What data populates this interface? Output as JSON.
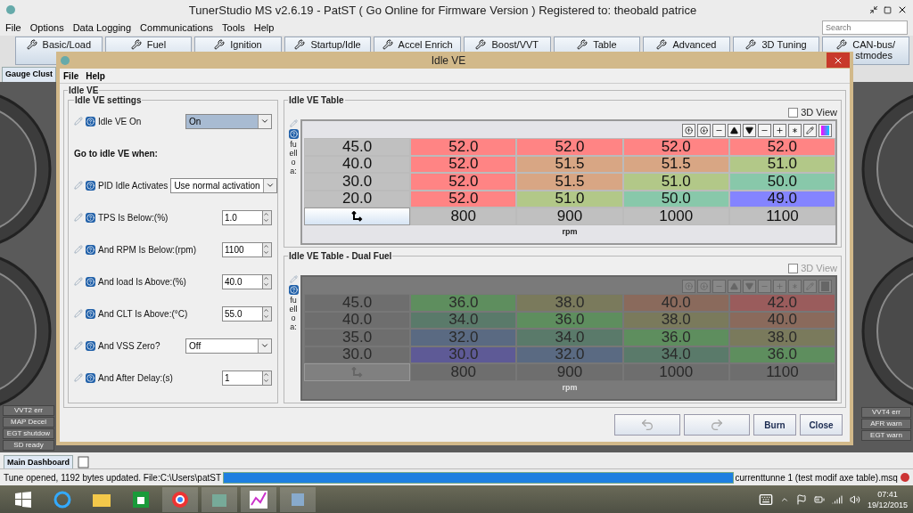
{
  "window": {
    "title": "TunerStudio MS v2.6.19 - PatST ( Go Online for Firmware Version ) Registered to: theobald patrice"
  },
  "menu": [
    "File",
    "Options",
    "Data Logging",
    "Communications",
    "Tools",
    "Help"
  ],
  "search": {
    "placeholder": "Search"
  },
  "toolbar": [
    {
      "label": "Basic/Load"
    },
    {
      "label": "Fuel"
    },
    {
      "label": "Ignition"
    },
    {
      "label": "Startup/Idle"
    },
    {
      "label": "Accel Enrich"
    },
    {
      "label": "Boost/VVT"
    },
    {
      "label": "Table"
    },
    {
      "label": "Advanced"
    },
    {
      "label": "3D Tuning"
    },
    {
      "label": "CAN-bus/",
      "label_2": "stmodes"
    }
  ],
  "tabs": [
    {
      "label": "Gauge Clust",
      "selected": true
    }
  ],
  "indicators_left": [
    "VVT2 err",
    "MAP Decel",
    "EGT shutdow",
    "SD ready"
  ],
  "indicators_right": [
    "VVT4 err",
    "AFR warn",
    "EGT warn"
  ],
  "dialog": {
    "title": "Idle VE",
    "menu": [
      "File",
      "Help"
    ],
    "group": "Idle VE",
    "settings": {
      "title": "Idle VE settings",
      "rows": [
        {
          "kind": "select",
          "label": "Idle VE On",
          "value": "On",
          "focused": true
        },
        {
          "kind": "heading",
          "label": "Go to idle VE when:"
        },
        {
          "kind": "select",
          "label": "PID Idle Activates",
          "value": "Use normal activation",
          "focused": false
        },
        {
          "kind": "spinner",
          "label": "TPS Is Below:(%)",
          "value": "1.0"
        },
        {
          "kind": "spinner",
          "label": "And RPM Is Below:(rpm)",
          "value": "1100"
        },
        {
          "kind": "spinner",
          "label": "And load Is Above:(%)",
          "value": "40.0"
        },
        {
          "kind": "spinner",
          "label": "And CLT Is Above:(°C)",
          "value": "55.0"
        },
        {
          "kind": "select",
          "label": "And VSS Zero?",
          "value": "Off",
          "focused": false
        },
        {
          "kind": "spinner",
          "label": "And After Delay:(s)",
          "value": "1"
        }
      ]
    },
    "tables": [
      {
        "title": "Idle VE Table",
        "enabled": true,
        "view_3d": {
          "label": "3D View",
          "checked": false
        },
        "y_axis_label": "fuelloa:",
        "x_axis_label": "rpm",
        "rpm": [
          "800",
          "900",
          "1000",
          "1100"
        ],
        "rows": [
          {
            "load": "45.0",
            "cells": [
              {
                "value": "52.0",
                "color": "#ff8484"
              },
              {
                "value": "52.0",
                "color": "#ff8484"
              },
              {
                "value": "52.0",
                "color": "#ff8484"
              },
              {
                "value": "52.0",
                "color": "#ff8484"
              }
            ]
          },
          {
            "load": "40.0",
            "cells": [
              {
                "value": "52.0",
                "color": "#ff8484"
              },
              {
                "value": "51.5",
                "color": "#d8a684"
              },
              {
                "value": "51.5",
                "color": "#d8a684"
              },
              {
                "value": "51.0",
                "color": "#b2c888"
              }
            ]
          },
          {
            "load": "30.0",
            "cells": [
              {
                "value": "52.0",
                "color": "#ff8484"
              },
              {
                "value": "51.5",
                "color": "#d8a684"
              },
              {
                "value": "51.0",
                "color": "#b2c888"
              },
              {
                "value": "50.0",
                "color": "#88c8aa"
              }
            ]
          },
          {
            "load": "20.0",
            "cells": [
              {
                "value": "52.0",
                "color": "#ff8484"
              },
              {
                "value": "51.0",
                "color": "#b2c888"
              },
              {
                "value": "50.0",
                "color": "#88c8aa"
              },
              {
                "value": "49.0",
                "color": "#8484ff"
              }
            ]
          }
        ]
      },
      {
        "title": "Idle VE Table - Dual Fuel",
        "enabled": false,
        "view_3d": {
          "label": "3D View",
          "checked": false
        },
        "y_axis_label": "fuelloa:",
        "x_axis_label": "rpm",
        "rpm": [
          "800",
          "900",
          "1000",
          "1100"
        ],
        "rows": [
          {
            "load": "45.0",
            "cells": [
              {
                "value": "36.0",
                "color": "#5e8e5e"
              },
              {
                "value": "38.0",
                "color": "#7a7a5c"
              },
              {
                "value": "40.0",
                "color": "#8a6a5c"
              },
              {
                "value": "42.0",
                "color": "#9a5c5c"
              }
            ]
          },
          {
            "load": "40.0",
            "cells": [
              {
                "value": "34.0",
                "color": "#5a7a6a"
              },
              {
                "value": "36.0",
                "color": "#5e8e5e"
              },
              {
                "value": "38.0",
                "color": "#7a7a5c"
              },
              {
                "value": "40.0",
                "color": "#8a6a5c"
              }
            ]
          },
          {
            "load": "35.0",
            "cells": [
              {
                "value": "32.0",
                "color": "#5a6a82"
              },
              {
                "value": "34.0",
                "color": "#5a7a6a"
              },
              {
                "value": "36.0",
                "color": "#5e8e5e"
              },
              {
                "value": "38.0",
                "color": "#7a7a5c"
              }
            ]
          },
          {
            "load": "30.0",
            "cells": [
              {
                "value": "30.0",
                "color": "#5e5a96"
              },
              {
                "value": "32.0",
                "color": "#5a6a82"
              },
              {
                "value": "34.0",
                "color": "#5a7a6a"
              },
              {
                "value": "36.0",
                "color": "#5e8e5e"
              }
            ]
          }
        ]
      }
    ],
    "buttons": [
      {
        "kind": "undo",
        "disabled": true
      },
      {
        "kind": "redo",
        "disabled": true
      },
      {
        "kind": "text",
        "label": "Burn",
        "disabled": false
      },
      {
        "kind": "text",
        "label": "Close",
        "disabled": false
      }
    ]
  },
  "bottom_tabs": [
    {
      "label": "Main Dashboard",
      "selected": true
    }
  ],
  "status_bar": {
    "message": "Tune opened, 1192 bytes updated. File:C:\\Users\\patST",
    "progress": {
      "level": 1
    },
    "file": "currenttunne 1 (test modif axe table).msq"
  },
  "taskbar": {
    "time": "07:41",
    "date": "19/12/2015"
  }
}
